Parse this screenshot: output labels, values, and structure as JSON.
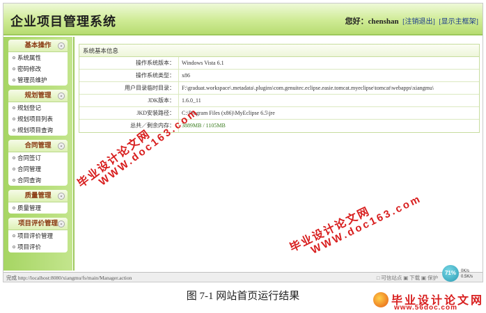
{
  "header": {
    "app_title": "企业项目管理系统",
    "greeting": "您好：chenshan",
    "logout_link": "[注销退出]",
    "home_link": "[显示主框架]"
  },
  "sidebar": {
    "groups": [
      {
        "title": "基本操作",
        "items": [
          "系统属性",
          "密码修改",
          "管理员维护"
        ]
      },
      {
        "title": "规划管理",
        "items": [
          "规划登记",
          "规划项目列表",
          "规划项目查询"
        ]
      },
      {
        "title": "合同管理",
        "items": [
          "合同签订",
          "合同管理",
          "合同查询"
        ]
      },
      {
        "title": "质量管理",
        "items": [
          "质量管理"
        ]
      },
      {
        "title": "项目评价管理",
        "items": [
          "项目评价管理",
          "项目评价"
        ]
      }
    ],
    "collapse_glyph": "«"
  },
  "main": {
    "panel_title": "系统基本信息",
    "rows": [
      {
        "label": "操作系统版本：",
        "value": "Windows Vista  6.1"
      },
      {
        "label": "操作系统类型：",
        "value": "x86"
      },
      {
        "label": "用户目录临时目录：",
        "value": "F:\\graduat.workspace\\.metadata\\.plugins\\com.genuitec.eclipse.easie.tomcat.myeclipse\\tomcat\\webapps\\xiangmu\\"
      },
      {
        "label": "JDK版本：",
        "value": "1.6.0_11"
      },
      {
        "label": "JKD安装路径：",
        "value": "C:\\Program Files (x86)\\MyEclipse 6.5\\jre"
      },
      {
        "label": "总共／剩余内存：",
        "value": "3889MB  /  1105MB"
      }
    ]
  },
  "statusbar": {
    "left_text": "完成    http://localhost:8080/xiangmu/fs/main/Manager.action",
    "right_text": "□ 可信站点    ▣ 下载  ▣ 保护",
    "gauge": "71%",
    "speed_up": "0K/s",
    "speed_down": "0.5K/s"
  },
  "caption": "图 7-1  网站首页运行结果",
  "watermark": {
    "cn": "毕业设计论文网",
    "url": "WWW.doc163.com"
  },
  "logo": {
    "cn": "毕业设计论文网",
    "url": "www.56doc.com"
  }
}
